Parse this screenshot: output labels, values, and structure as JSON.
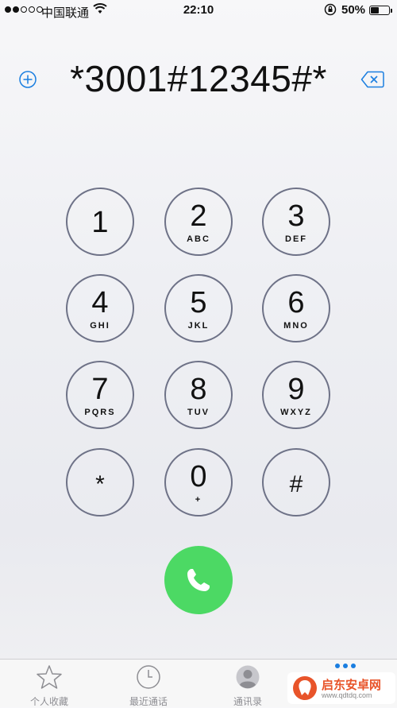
{
  "status_bar": {
    "signal_dots_filled": 2,
    "signal_dots_total": 5,
    "carrier": "中国联通",
    "time": "22:10",
    "battery_percent": "50%",
    "battery_level": 0.5
  },
  "dialer": {
    "dialed_number": "*3001#12345#*",
    "add_contact_icon": "plus-circle-icon",
    "backspace_icon": "backspace-icon",
    "accent_color": "#1a7ee0"
  },
  "keypad": [
    {
      "digit": "1",
      "letters": ""
    },
    {
      "digit": "2",
      "letters": "ABC"
    },
    {
      "digit": "3",
      "letters": "DEF"
    },
    {
      "digit": "4",
      "letters": "GHI"
    },
    {
      "digit": "5",
      "letters": "JKL"
    },
    {
      "digit": "6",
      "letters": "MNO"
    },
    {
      "digit": "7",
      "letters": "PQRS"
    },
    {
      "digit": "8",
      "letters": "TUV"
    },
    {
      "digit": "9",
      "letters": "WXYZ"
    },
    {
      "digit": "*",
      "letters": ""
    },
    {
      "digit": "0",
      "letters": "+"
    },
    {
      "digit": "#",
      "letters": ""
    }
  ],
  "call_button": {
    "icon": "phone-icon",
    "color": "#4cd964"
  },
  "tab_bar": {
    "tabs": [
      {
        "label": "个人收藏",
        "icon": "star-icon"
      },
      {
        "label": "最近通话",
        "icon": "clock-icon"
      },
      {
        "label": "通讯录",
        "icon": "contact-icon"
      }
    ],
    "watermark_text": "启东安卓网",
    "watermark_url": "www.qdtdq.com"
  }
}
